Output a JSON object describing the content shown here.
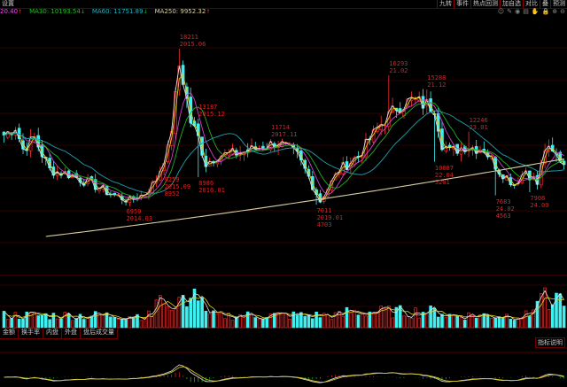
{
  "toolbar": {
    "settings_label": "设置",
    "buttons": [
      "九转",
      "事件",
      "热点回测",
      "加自选",
      "对比",
      "叠",
      "预测"
    ],
    "icons": [
      "smile-icon",
      "pencil-icon",
      "eye-icon",
      "layers-icon",
      "hand-icon",
      "lock-icon",
      "zoom-in-icon",
      "zoom-out-icon"
    ]
  },
  "ma_legend": [
    {
      "text": "20.40",
      "arrow": "↑",
      "color": "#ff40ff"
    },
    {
      "text": "MA30: 10193.54",
      "arrow": "↓",
      "color": "#20c020"
    },
    {
      "text": "MA60: 11751.89",
      "arrow": "↓",
      "color": "#20b0c0"
    },
    {
      "text": "MA250: 9952.32",
      "arrow": "↑",
      "color": "#d8d0a0"
    }
  ],
  "colors": {
    "up": "#ff3030",
    "down": "#40f0f0",
    "grid": "#5a0000",
    "ma5": "#e0e0e0",
    "ma10": "#e0d020",
    "ma20": "#d040d0",
    "ma30": "#20b020",
    "ma60": "#20a0b0",
    "ma250": "#d8d0a0",
    "annotation": "#e02020"
  },
  "volume_tabs": [
    "金额",
    "换手率",
    "内盘",
    "外盘",
    "盘后成交量"
  ],
  "indicator_button": "指标说明",
  "chart_data": {
    "type": "candlestick",
    "ylim": [
      3270,
      20560
    ],
    "bars": 148,
    "key_points": [
      [
        0,
        12000
      ],
      [
        3,
        12600
      ],
      [
        5,
        11000
      ],
      [
        8,
        11800
      ],
      [
        12,
        9500
      ],
      [
        17,
        9200
      ],
      [
        23,
        8500
      ],
      [
        28,
        7800
      ],
      [
        33,
        7300
      ],
      [
        37,
        7800
      ],
      [
        40,
        8800
      ],
      [
        43,
        11000
      ],
      [
        44,
        12500
      ],
      [
        46,
        17000
      ],
      [
        47,
        16000
      ],
      [
        49,
        13000
      ],
      [
        51,
        11800
      ],
      [
        53,
        10000
      ],
      [
        56,
        10500
      ],
      [
        63,
        10800
      ],
      [
        72,
        11500
      ],
      [
        77,
        10500
      ],
      [
        80,
        9000
      ],
      [
        83,
        7300
      ],
      [
        88,
        9500
      ],
      [
        93,
        10500
      ],
      [
        98,
        12500
      ],
      [
        103,
        14000
      ],
      [
        107,
        14500
      ],
      [
        113,
        14000
      ],
      [
        115,
        11500
      ],
      [
        117,
        10800
      ],
      [
        121,
        11200
      ],
      [
        126,
        11000
      ],
      [
        130,
        9500
      ],
      [
        134,
        8500
      ],
      [
        137,
        9500
      ],
      [
        140,
        8500
      ],
      [
        142,
        11000
      ],
      [
        145,
        10500
      ],
      [
        147,
        10000
      ]
    ],
    "ma250_range": [
      4733,
      10300
    ],
    "annotations": [
      {
        "lines": [
          "18211",
          "2015.06"
        ],
        "bar": 46,
        "price": 18211,
        "pos": "above"
      },
      {
        "lines": [
          "13187",
          "2015.12"
        ],
        "bar": 51,
        "price": 13187,
        "pos": "above"
      },
      {
        "lines": [
          "11714",
          "2017.11"
        ],
        "bar": 70,
        "price": 11714,
        "pos": "above"
      },
      {
        "lines": [
          "6959",
          "2014.03"
        ],
        "bar": 32,
        "price": 6959,
        "pos": "below"
      },
      {
        "lines": [
          "9259",
          "2015.09",
          "8952"
        ],
        "bar": 42,
        "price": 9259,
        "pos": "below"
      },
      {
        "lines": [
          "8986",
          "2016.01"
        ],
        "bar": 51,
        "price": 8986,
        "pos": "below"
      },
      {
        "lines": [
          "7011",
          "2019.01",
          "4703"
        ],
        "bar": 82,
        "price": 7011,
        "pos": "below"
      },
      {
        "lines": [
          "16293",
          "21.02"
        ],
        "bar": 101,
        "price": 16293,
        "pos": "above"
      },
      {
        "lines": [
          "15288",
          "21.12"
        ],
        "bar": 111,
        "price": 15288,
        "pos": "above"
      },
      {
        "lines": [
          "12246",
          "23.01"
        ],
        "bar": 122,
        "price": 12246,
        "pos": "above"
      },
      {
        "lines": [
          "10087",
          "22.04",
          "5201"
        ],
        "bar": 113,
        "price": 10087,
        "pos": "below"
      },
      {
        "lines": [
          "7683",
          "24.02",
          "4563"
        ],
        "bar": 129,
        "price": 7683,
        "pos": "below"
      },
      {
        "lines": [
          "7908",
          "24.09"
        ],
        "bar": 138,
        "price": 7908,
        "pos": "below"
      }
    ]
  }
}
